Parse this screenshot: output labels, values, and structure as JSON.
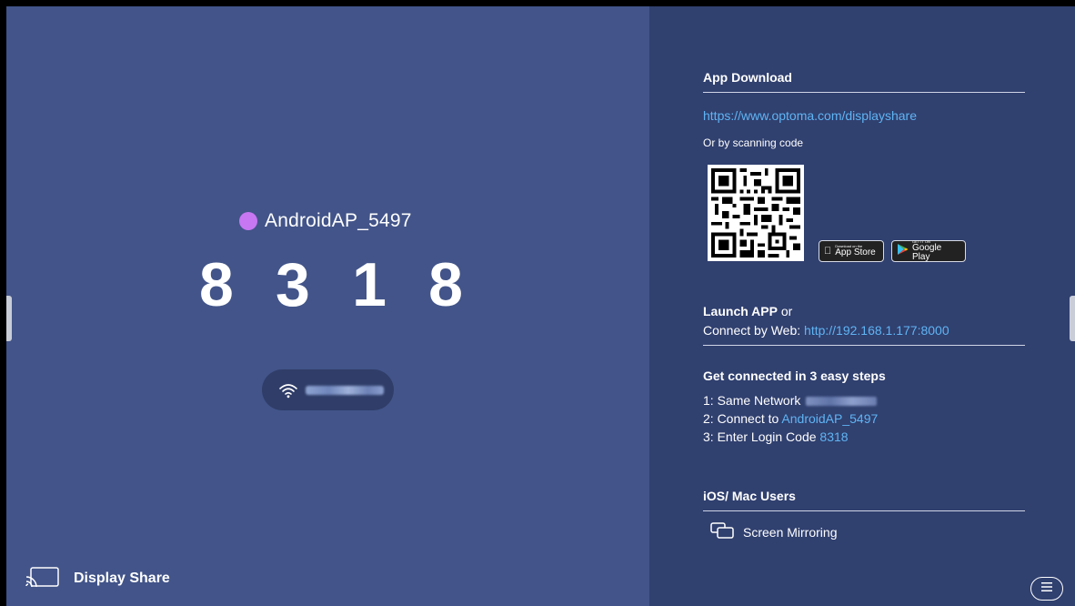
{
  "left": {
    "device_name": "AndroidAP_5497",
    "device_dot_color": "#c777f2",
    "code_digits": [
      "8",
      "3",
      "1",
      "8"
    ],
    "wifi_icon": "wifi-icon",
    "brand_icon": "cast-icon",
    "brand_label": "Display Share"
  },
  "right": {
    "app_download_title": "App Download",
    "download_url": "https://www.optoma.com/displayshare",
    "scan_text": "Or by scanning code",
    "app_store_small": "Download on the",
    "app_store_big": "App Store",
    "google_play_small": "GET IT ON",
    "google_play_big": "Google Play",
    "launch_app": "Launch APP",
    "launch_or": "or",
    "connect_web_label": "Connect by Web:",
    "connect_web_url": "http://192.168.1.177:8000",
    "steps_title": "Get connected in 3 easy steps",
    "step1": "1: Same Network",
    "step2_prefix": "2: Connect to",
    "step2_value": "AndroidAP_5497",
    "step3_prefix": "3: Enter Login Code",
    "step3_value": "8318",
    "ios_title": "iOS/ Mac Users",
    "screen_mirroring": "Screen Mirroring",
    "mirroring_icon": "screen-mirroring-icon",
    "menu_icon": "menu-icon"
  },
  "colors": {
    "left_bg": "#425489",
    "right_bg": "#30406f",
    "link": "#5fb4f4"
  }
}
